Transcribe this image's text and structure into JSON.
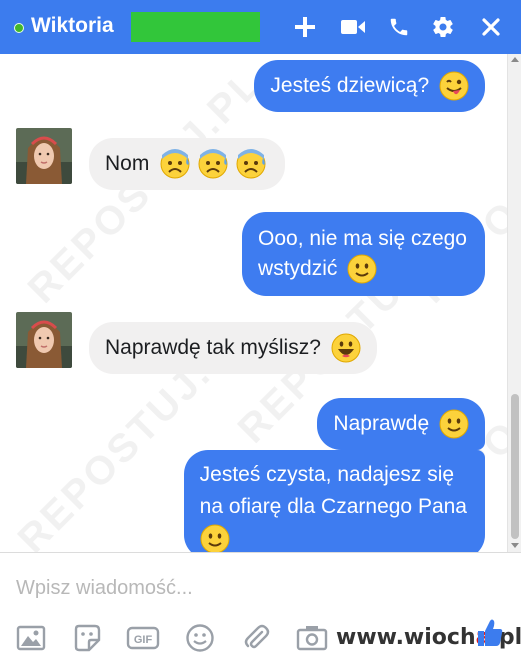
{
  "header": {
    "contact_name": "Wiktoria",
    "icons": [
      "plus-icon",
      "video-camera-icon",
      "phone-icon",
      "gear-icon",
      "close-icon"
    ],
    "accent_color": "#3c7cee",
    "online_color": "#42b72a"
  },
  "messages": [
    {
      "direction": "outgoing",
      "text": "Jesteś dziewicą?",
      "emoji": "winking-tongue-emoji"
    },
    {
      "direction": "incoming",
      "text": "Nom",
      "emoji": "anxious-sweat-emoji x3"
    },
    {
      "direction": "outgoing",
      "line1": "Ooo, nie ma się czego",
      "line2": "wstydzić",
      "emoji": "slight-smile-emoji"
    },
    {
      "direction": "incoming",
      "text": "Naprawdę tak myślisz?",
      "emoji": "grinning-emoji"
    },
    {
      "direction": "outgoing",
      "text": "Naprawdę",
      "emoji": "slight-smile-emoji"
    },
    {
      "direction": "outgoing",
      "line1": "Jesteś czysta, nadajesz się",
      "line2": "na ofiarę dla Czarnego Pana",
      "emoji": "slight-smile-emoji"
    }
  ],
  "composer": {
    "placeholder": "Wpisz wiadomość...",
    "tools": [
      "image-icon",
      "sticker-icon",
      "gif-icon",
      "emoji-icon",
      "attachment-icon",
      "camera-icon",
      "like-icon"
    ]
  },
  "watermark": "REPOSTUJ.PL",
  "site_mark": {
    "part1": "www.wioch",
    "part2": "a",
    "part3": ".pl"
  }
}
